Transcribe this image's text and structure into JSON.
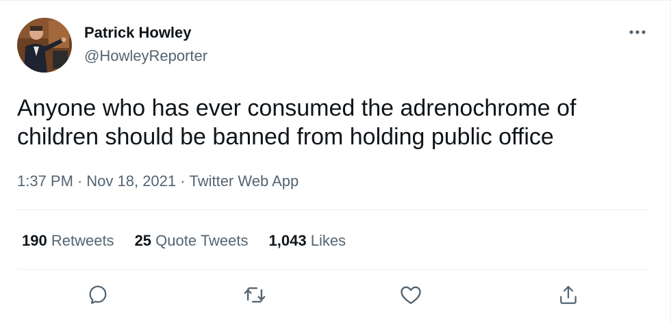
{
  "author": {
    "display_name": "Patrick Howley",
    "handle": "@HowleyReporter"
  },
  "tweet": {
    "text": "Anyone who has ever consumed the adrenochrome of children should be banned from holding public office",
    "time": "1:37 PM",
    "date": "Nov 18, 2021",
    "separator": "·",
    "source": "Twitter Web App"
  },
  "stats": {
    "retweets": {
      "count": "190",
      "label": "Retweets"
    },
    "quote_tweets": {
      "count": "25",
      "label": "Quote Tweets"
    },
    "likes": {
      "count": "1,043",
      "label": "Likes"
    }
  },
  "icons": {
    "more": "more-horizontal-icon",
    "reply": "reply-icon",
    "retweet": "retweet-icon",
    "like": "heart-icon",
    "share": "share-icon"
  },
  "colors": {
    "text_primary": "#0f1419",
    "text_secondary": "#536471",
    "divider": "#ebeef0"
  }
}
